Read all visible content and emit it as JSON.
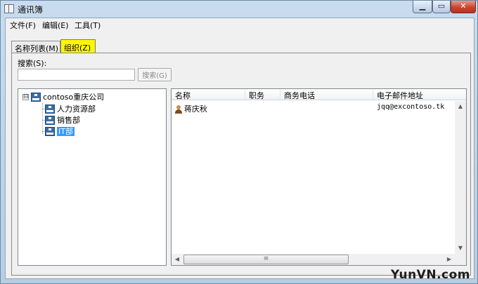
{
  "window": {
    "title": "通讯簿"
  },
  "menubar": {
    "items": [
      "文件(F)",
      "编辑(E)",
      "工具(T)"
    ]
  },
  "tabs": [
    {
      "label": "名称列表(M)"
    },
    {
      "label": "组织(Z)"
    }
  ],
  "search": {
    "label": "搜索(S):",
    "value": "",
    "button_label": "搜索(G)"
  },
  "tree": {
    "root": {
      "label": "contoso重庆公司",
      "expander": "⊟"
    },
    "children": [
      {
        "label": "人力资源部"
      },
      {
        "label": "销售部"
      },
      {
        "label": "IT部"
      }
    ],
    "selected": "IT部"
  },
  "list": {
    "columns": [
      "名称",
      "职务",
      "商务电话",
      "电子邮件地址"
    ],
    "rows": [
      {
        "name": "蒋庆秋",
        "title": "",
        "phone": "",
        "email": "jqq@excontoso.tk"
      }
    ]
  },
  "watermark": "YunVN.com"
}
